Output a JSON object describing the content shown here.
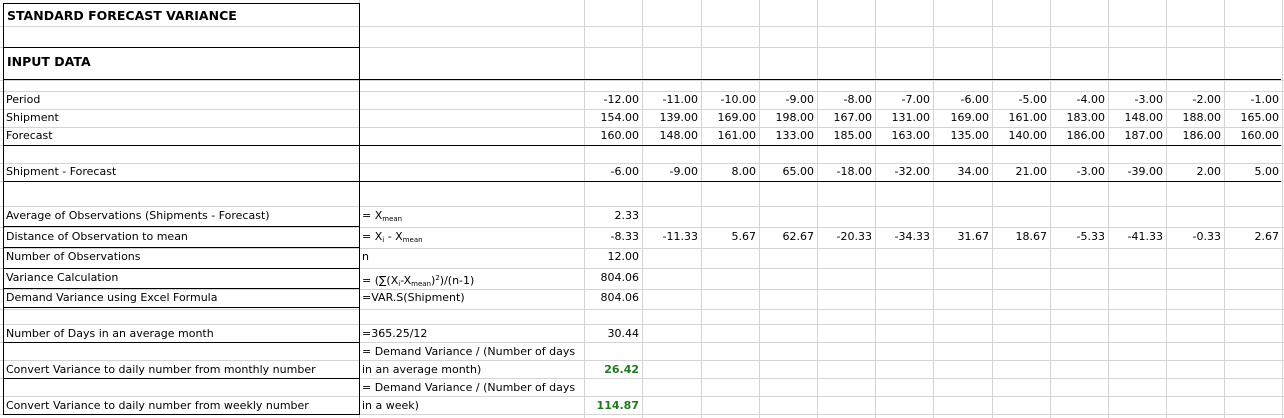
{
  "sheet": {
    "title": "STANDARD FORECAST VARIANCE",
    "section_title": "INPUT DATA",
    "period_label": "Period",
    "shipment_label": "Shipment",
    "forecast_label": "Forecast",
    "periods": [
      "-12.00",
      "-11.00",
      "-10.00",
      "-9.00",
      "-8.00",
      "-7.00",
      "-6.00",
      "-5.00",
      "-4.00",
      "-3.00",
      "-2.00",
      "-1.00"
    ],
    "shipments": [
      "154.00",
      "139.00",
      "169.00",
      "198.00",
      "167.00",
      "131.00",
      "169.00",
      "161.00",
      "183.00",
      "148.00",
      "188.00",
      "165.00"
    ],
    "forecasts": [
      "160.00",
      "148.00",
      "161.00",
      "133.00",
      "185.00",
      "163.00",
      "135.00",
      "140.00",
      "186.00",
      "187.00",
      "186.00",
      "160.00"
    ],
    "diff_label": "Shipment - Forecast",
    "diffs": [
      "-6.00",
      "-9.00",
      "8.00",
      "65.00",
      "-18.00",
      "-32.00",
      "34.00",
      "21.00",
      "-3.00",
      "-39.00",
      "2.00",
      "5.00"
    ],
    "avg_label": "Average of Observations (Shipments - Forecast)",
    "avg_formula_prefix": "= X",
    "avg_formula_sub": "mean",
    "avg_value": "2.33",
    "dist_label": "Distance of Observation to mean",
    "dist_formula_a": "= X",
    "dist_formula_sub_i": "i",
    "dist_formula_b": " - X",
    "dist_formula_sub_mean": "mean",
    "dist_values": [
      "-8.33",
      "-11.33",
      "5.67",
      "62.67",
      "-20.33",
      "-34.33",
      "31.67",
      "18.67",
      "-5.33",
      "-41.33",
      "-0.33",
      "2.67"
    ],
    "n_label": "Number of Observations",
    "n_formula": "n",
    "n_value": "12.00",
    "var_label": "Variance Calculation",
    "var_formula_a": "= (∑(X",
    "var_formula_sub_i": "i",
    "var_formula_b": "-X",
    "var_formula_sub_mean": "mean",
    "var_formula_c": ")",
    "var_formula_sup": "2",
    "var_formula_d": ")/(n-1)",
    "var_value": "804.06",
    "excel_label": "Demand Variance using Excel Formula",
    "excel_formula": "=VAR.S(Shipment)",
    "excel_value": "804.06",
    "days_label": "Number of Days in an average month",
    "days_formula": "=365.25/12",
    "days_value": "30.44",
    "monthly_label": "Convert Variance to daily number from monthly number",
    "monthly_formula_line1": "= Demand Variance / (Number of days",
    "monthly_formula_line2": "in an average month)",
    "monthly_value": "26.42",
    "weekly_label": "Convert Variance to daily number from weekly number",
    "weekly_formula_line1": "= Demand Variance / (Number of days",
    "weekly_formula_line2": "in a week)",
    "weekly_value": "114.87"
  }
}
